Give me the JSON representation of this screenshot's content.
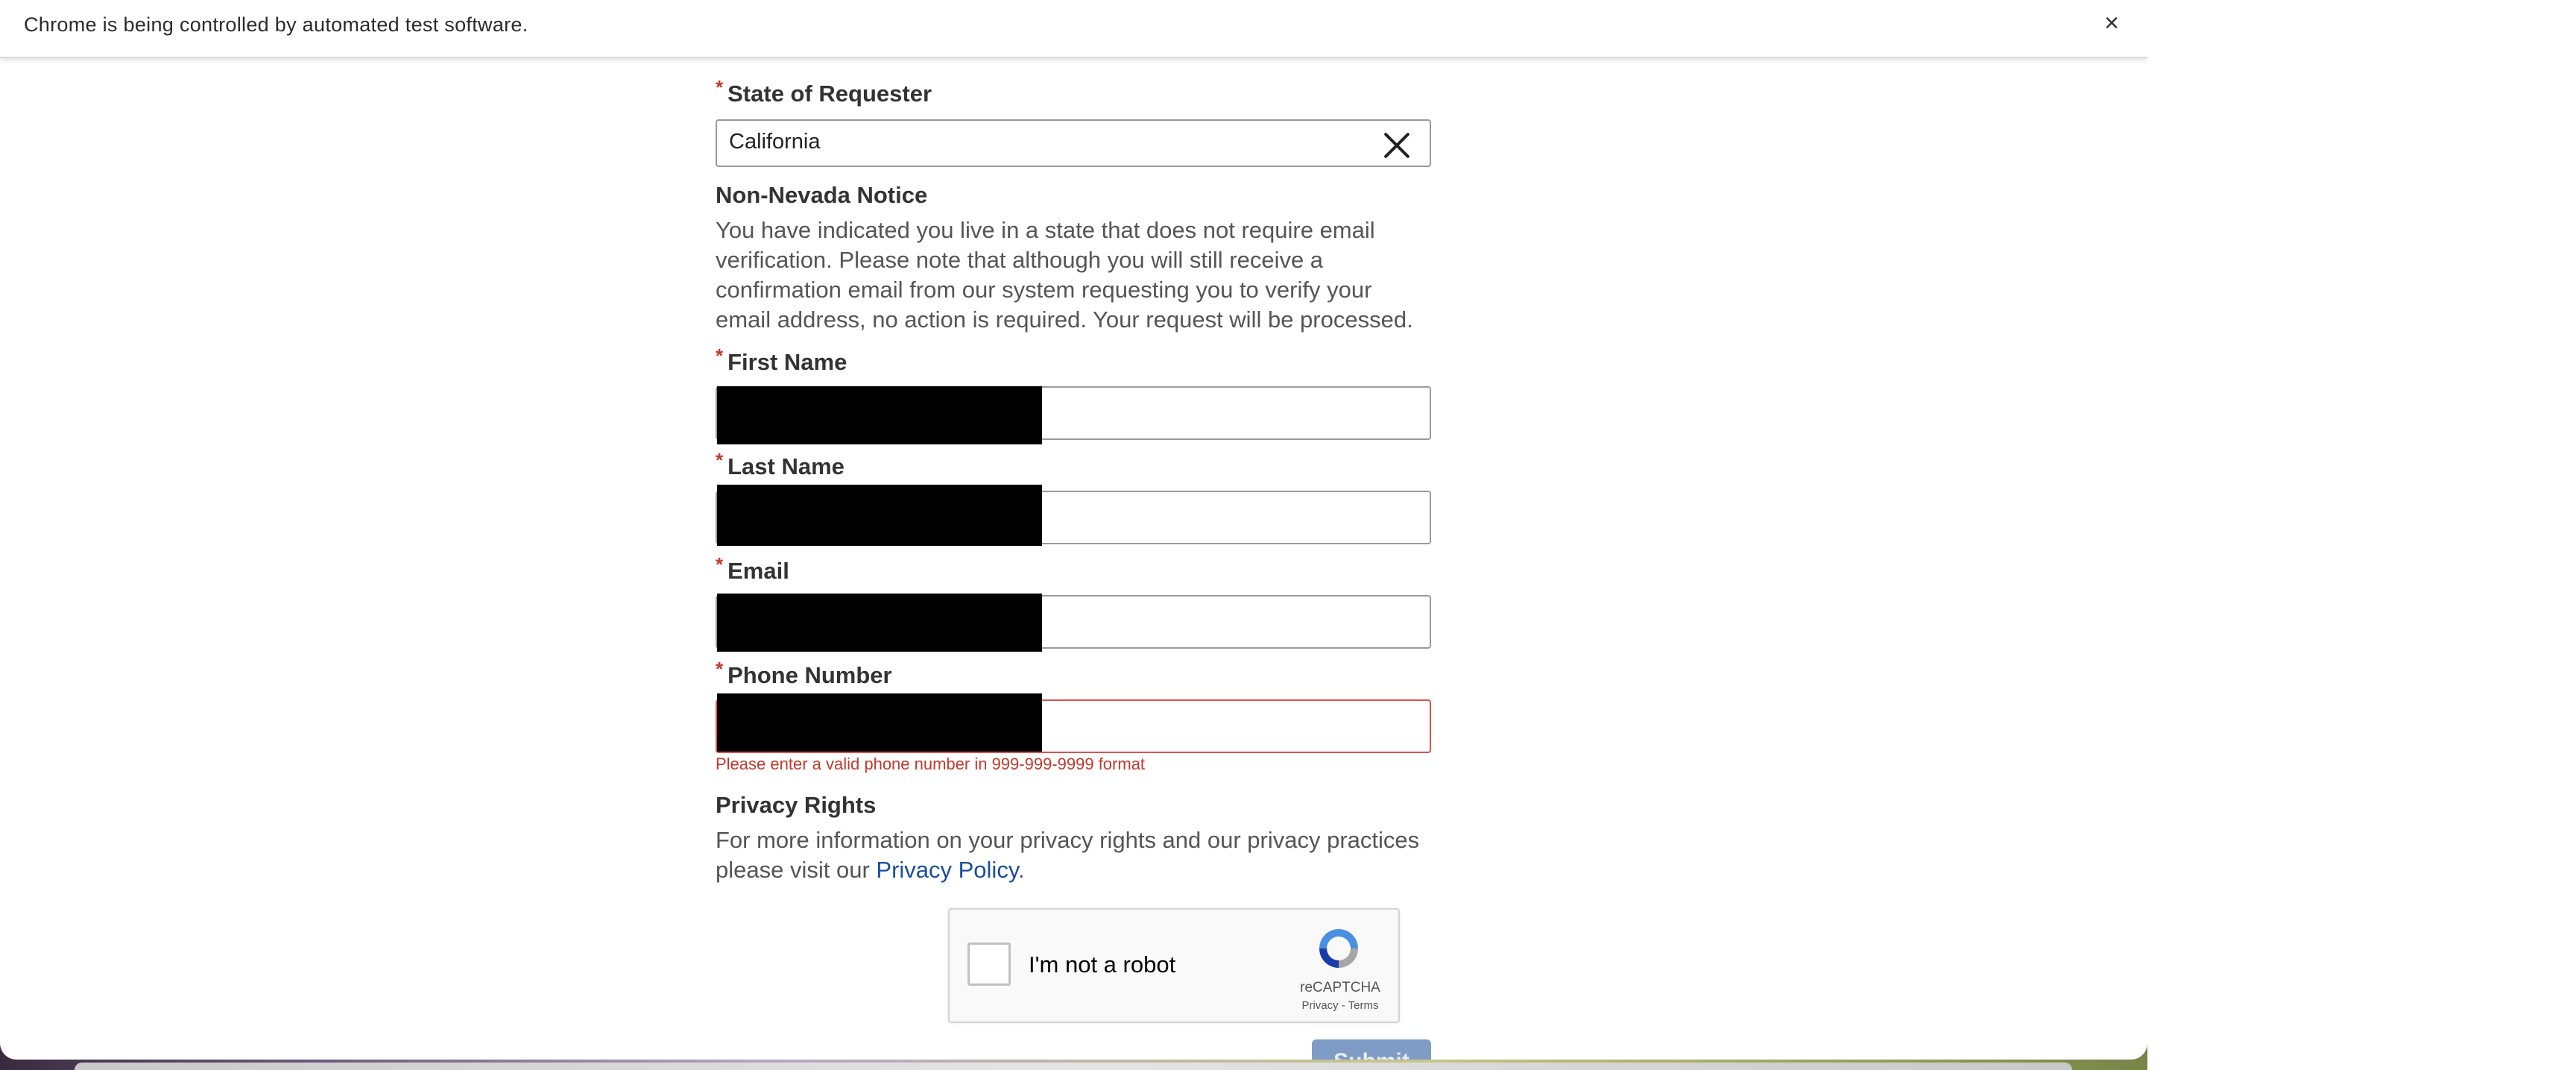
{
  "infobar": {
    "message": "Chrome is being controlled by automated test software.",
    "close_symbol": "×"
  },
  "form": {
    "state": {
      "label": "State of Requester",
      "required_mark": "*",
      "value": "California"
    },
    "notice": {
      "heading": "Non-Nevada Notice",
      "body": "You have indicated you live in a state that does not require email verification. Please note that although you will still receive a confirmation email from our system requesting you to verify your email address, no action is required. Your request will be processed."
    },
    "first_name": {
      "label": "First Name",
      "required_mark": "*"
    },
    "last_name": {
      "label": "Last Name",
      "required_mark": "*"
    },
    "email": {
      "label": "Email",
      "required_mark": "*"
    },
    "phone": {
      "label": "Phone Number",
      "required_mark": "*",
      "error": "Please enter a valid phone number in 999-999-9999 format"
    },
    "privacy": {
      "heading": "Privacy Rights",
      "body_prefix": "For more information on your privacy rights and our privacy practices please visit our ",
      "link": "Privacy Policy",
      "body_suffix": "."
    },
    "captcha": {
      "label": "I'm not a robot",
      "brand": "reCAPTCHA",
      "terms": "Privacy - Terms",
      "icon": "recaptcha-icon"
    },
    "submit_label": "Submit"
  },
  "colors": {
    "required": "#c0392b",
    "error": "#c0392b",
    "link": "#1a4e9c",
    "submit_bg": "#7f9cc7"
  }
}
